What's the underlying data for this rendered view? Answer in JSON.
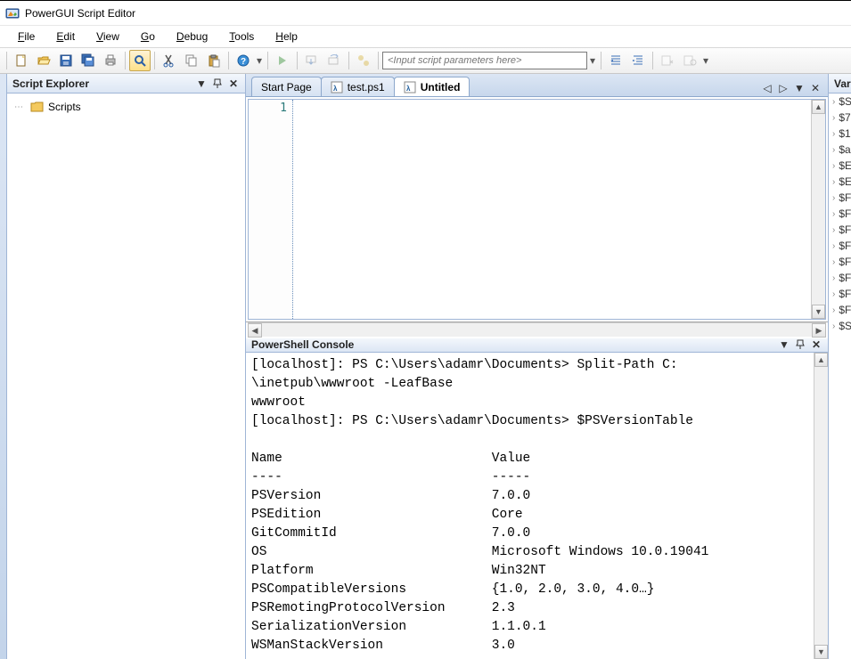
{
  "app": {
    "title": "PowerGUI Script Editor"
  },
  "menu": {
    "file": "File",
    "edit": "Edit",
    "view": "View",
    "go": "Go",
    "debug": "Debug",
    "tools": "Tools",
    "help": "Help"
  },
  "toolbar": {
    "input_placeholder": "<Input script parameters here>"
  },
  "explorer": {
    "title": "Script Explorer",
    "root": "Scripts"
  },
  "tabs": {
    "start": "Start Page",
    "test": "test.ps1",
    "untitled": "Untitled"
  },
  "editor": {
    "line1": "1"
  },
  "console": {
    "title": "PowerShell Console",
    "l1": "[localhost]: PS C:\\Users\\adamr\\Documents> Split-Path C:",
    "l2": "\\inetpub\\wwwroot -LeafBase",
    "l3": "wwwroot",
    "l4": "[localhost]: PS C:\\Users\\adamr\\Documents> $PSVersionTable",
    "blank": "",
    "h_name": "Name",
    "h_value": "Value",
    "h_ndash": "----",
    "h_vdash": "-----",
    "r1n": "PSVersion",
    "r1v": "7.0.0",
    "r2n": "PSEdition",
    "r2v": "Core",
    "r3n": "GitCommitId",
    "r3v": "7.0.0",
    "r4n": "OS",
    "r4v": "Microsoft Windows 10.0.19041",
    "r5n": "Platform",
    "r5v": "Win32NT",
    "r6n": "PSCompatibleVersions",
    "r6v": "{1.0, 2.0, 3.0, 4.0…}",
    "r7n": "PSRemotingProtocolVersion",
    "r7v": "2.3",
    "r8n": "SerializationVersion",
    "r8v": "1.1.0.1",
    "r9n": "WSManStackVersion",
    "r9v": "3.0"
  },
  "variables": {
    "title": "Variab",
    "items": [
      "$S",
      "$7",
      "$1",
      "$a",
      "$E",
      "$E",
      "$F",
      "$F",
      "$F",
      "$F",
      "$F",
      "$F",
      "$F",
      "$F",
      "$S"
    ]
  }
}
